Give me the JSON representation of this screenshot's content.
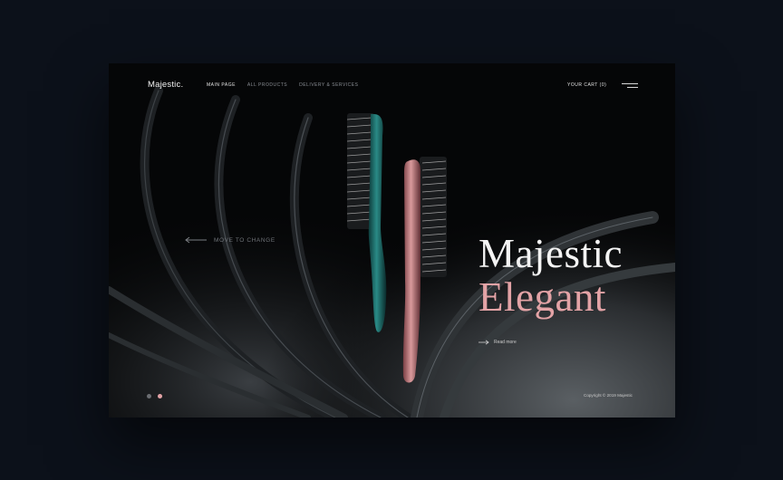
{
  "header": {
    "brand": "Majestic.",
    "nav": [
      "MAIN PAGE",
      "ALL PRODUCTS",
      "DELIVERY & SERVICES"
    ],
    "cart": "YOUR CART (0)"
  },
  "hero": {
    "move_hint": "MOVE TO CHANGE",
    "title_line1": "Majestic",
    "title_line2": "Elegant",
    "read_more": "Read more"
  },
  "slider": {
    "count": 2,
    "active_index": 1
  },
  "footer": {
    "copyright": "Copyright © 2019 Majestic"
  },
  "colors": {
    "background": "#0c111a",
    "panel": "#050607",
    "accent_pink": "#e3a3a6",
    "teal": "#1f7b78"
  },
  "icons": [
    "arrow-left-icon",
    "hamburger-menu-icon",
    "arrow-right-icon"
  ]
}
